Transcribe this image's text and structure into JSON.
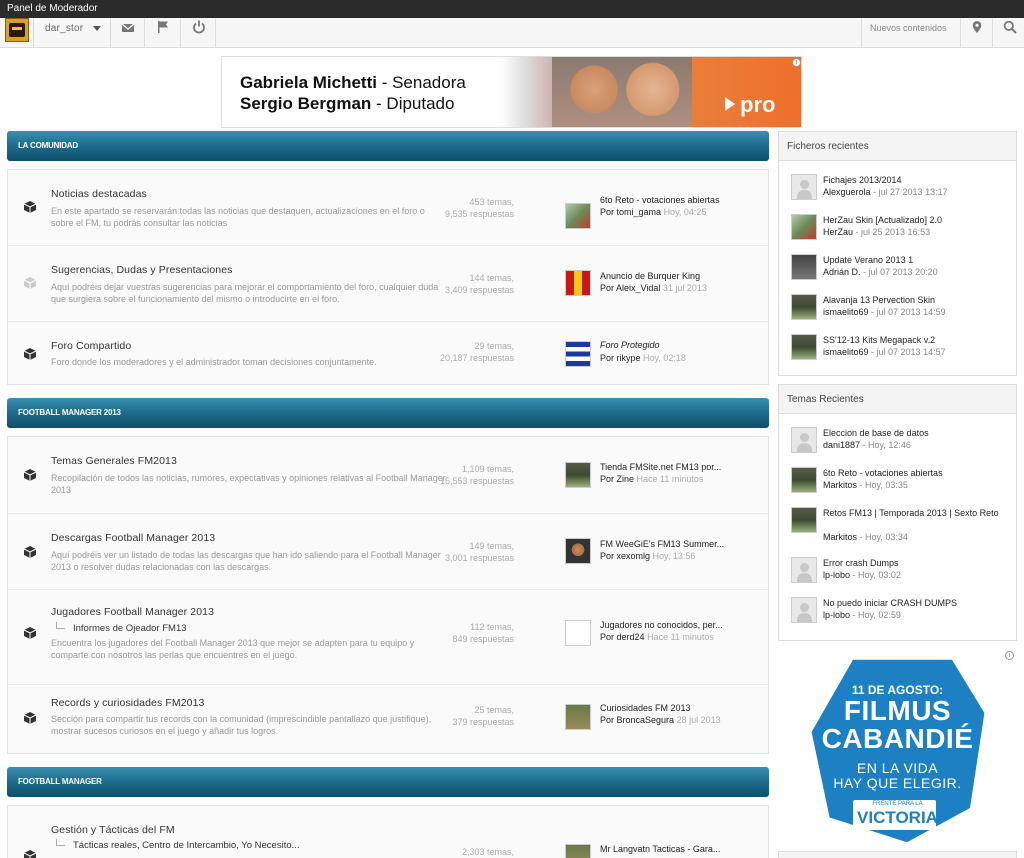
{
  "modbar": {
    "label": "Panel de Moderador"
  },
  "navbar": {
    "username": "dar_stor",
    "new_content": "Nuevos contenidos",
    "icons": [
      "user-avatar",
      "envelope-icon",
      "flag-icon",
      "power-icon",
      "location-pin-icon",
      "search-icon"
    ]
  },
  "banner_top": {
    "line1_name": "Gabriela Michetti",
    "line1_role": " - Senadora",
    "line2_name": "Sergio Bergman",
    "line2_role": " - Diputado",
    "brand": "pro",
    "ad_badge": "i"
  },
  "categories": [
    {
      "title": "LA COMUNIDAD",
      "forums": [
        {
          "title": "Noticias destacadas",
          "desc": "En este apartado se reservarán todas las noticias que destaquen, actualizaciones en el foro o sobre el FM, tu podrás consultar las noticias",
          "topics": "453 temas,",
          "replies": "9,535 respuestas",
          "last_title": "6to Reto - votaciones abiertas",
          "last_by_label": "Por ",
          "last_by": "tomi_gama",
          "last_time": "Hoy, 04:25",
          "icon_read": false
        },
        {
          "title": "Sugerencias, Dudas y Presentaciones",
          "desc": "Aquí podréis dejar vuestras sugerencias para mejorar el comportamiento del foro, cualquier duda que surgiera sobre el funcionamiento del mismo o introducirte en el foro.",
          "topics": "144 temas,",
          "replies": "3,409 respuestas",
          "last_title": "Anuncio de Burquer King",
          "last_by_label": "Por ",
          "last_by": "Aleix_Vidal",
          "last_time": "31 jul 2013",
          "icon_read": true
        },
        {
          "title": "Foro Compartido",
          "desc": "Foro donde los moderadores y el administrador toman decisiones conjuntamente.",
          "topics": "29 temas,",
          "replies": "20,187 respuestas",
          "last_title": "Foro Protegido",
          "last_by_label": "Por ",
          "last_by": "rikype",
          "last_time": "Hoy, 02:18",
          "icon_read": false
        }
      ]
    },
    {
      "title": "FOOTBALL MANAGER 2013",
      "forums": [
        {
          "title": "Temas Generales FM2013",
          "desc": "Recopilación de todos las noticias, rumores, expectativas y opiniones relativas al Football Manager 2013",
          "topics": "1,109 temas,",
          "replies": "15,553 respuestas",
          "last_title": "Tienda FMSite.net FM13 por...",
          "last_by_label": "Por ",
          "last_by": "Zine",
          "last_time": "Hace 11 minutos",
          "icon_read": false
        },
        {
          "title": "Descargas Football Manager 2013",
          "desc": "Aquí podréis ver un listado de todas las descargas que han ido saliendo para el Football Manager 2013 o resolver dudas relacionadas con las descargas.",
          "topics": "149 temas,",
          "replies": "3,001 respuestas",
          "last_title": "FM WeeGiE's FM13 Summer...",
          "last_by_label": "Por ",
          "last_by": "xexomlg",
          "last_time": "Hoy, 13:56",
          "icon_read": false
        },
        {
          "title": "Jugadores Football Manager 2013",
          "subforums": [
            "Informes de Ojeador FM13"
          ],
          "desc": "Encuentra los jugadores del Football Manager 2013 que mejor se adapten para tu equipo y comparte con nosotros las perlas que encuentres en el juego.",
          "topics": "112 temas,",
          "replies": "849 respuestas",
          "last_title": "Jugadores no conocidos, per...",
          "last_by_label": "Por ",
          "last_by": "derd24",
          "last_time": "Hace 11 minutos",
          "icon_read": false
        },
        {
          "title": "Records y curiosidades FM2013",
          "desc": "Sección para compartir tus records con la comunidad (imprescindible pantallazo que justifique), mostrar sucesos curiosos en el juego y añadir tus logros.",
          "topics": "25 temas,",
          "replies": "379 respuestas",
          "last_title": "Curiosidades FM 2013",
          "last_by_label": "Por ",
          "last_by": "BroncaSegura",
          "last_time": "28 jul 2013",
          "icon_read": false
        }
      ]
    },
    {
      "title": "FOOTBALL MANAGER",
      "forums": [
        {
          "title": "Gestión y Tácticas del FM",
          "subforums_line": "Tácticas reales,   Centro de Intercambio,   Yo Necesito...",
          "topics": "2,303 temas,",
          "last_title": "Mr Langvatn Tacticas - Gara...",
          "icon_read": false
        }
      ]
    }
  ],
  "widgets": {
    "files": {
      "title": "Ficheros recientes",
      "items": [
        {
          "title": "Fichajes 2013/2014",
          "user": "Alexguerola",
          "time": " - jul 27 2013 13:17"
        },
        {
          "title": "HerZau Skin [Actualizado] 2.0",
          "user": "HerZau",
          "time": " - jul 25 2013 16:53"
        },
        {
          "title": "Update Verano 2013 1",
          "user": "Adrián D.",
          "time": " - jul 07 2013 20:20"
        },
        {
          "title": "Alavanja 13 Pervection Skin",
          "user": "ismaelito69",
          "time": " - jul 07 2013 14:59"
        },
        {
          "title": "SS'12-13 Kits Megapack v.2",
          "user": "ismaelito69",
          "time": " - jul 07 2013 14:57"
        }
      ]
    },
    "topics": {
      "title": "Temas Recientes",
      "items": [
        {
          "title": "Eleccion de base de datos",
          "user": "dani1887",
          "time": " - Hoy, 12:46"
        },
        {
          "title": "6to Reto - votaciones abiertas",
          "user": "Markitos",
          "time": " - Hoy, 03:35"
        },
        {
          "title": "Retos FM13 | Temporada 2013 | Sexto Reto",
          "user": "Markitos",
          "time": " - Hoy, 03:34"
        },
        {
          "title": "Error crash Dumps",
          "user": "lp-lobo",
          "time": " - Hoy, 03:02"
        },
        {
          "title": "No puedo iniciar CRASH DUMPS",
          "user": "lp-lobo",
          "time": " - Hoy, 02:59"
        }
      ]
    }
  },
  "banner_side": {
    "l1": "11 DE AGOSTO:",
    "l2": "FILMUS",
    "l3": "CABANDIÉ",
    "l4": "EN LA VIDA",
    "l5": "HAY QUE ELEGIR.",
    "l6": "FRENTE PARA LA",
    "l7": "VICTORIA",
    "ad_badge": "i"
  }
}
